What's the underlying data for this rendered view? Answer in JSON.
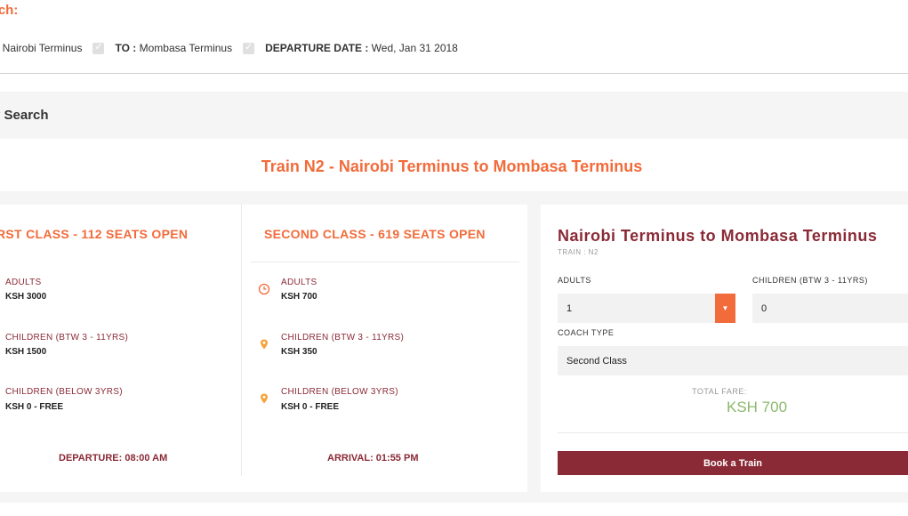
{
  "search_heading": "rch:",
  "summary": {
    "from_value": ": Nairobi Terminus",
    "to_label": "TO :",
    "to_value": " Mombasa Terminus",
    "date_label": "DEPARTURE DATE :",
    "date_value": " Wed, Jan 31 2018"
  },
  "modify_search": "y Search",
  "train_title": "Train N2 - Nairobi Terminus to Mombasa Terminus",
  "first_class": {
    "heading": "RST CLASS - 112 SEATS OPEN",
    "adults_label": "ADULTS",
    "adults_price": "KSH 3000",
    "children_label": "CHILDREN (BTW 3 - 11YRS)",
    "children_price": "KSH 1500",
    "infants_label": "CHILDREN (BELOW 3YRS)",
    "infants_price": "KSH 0 - FREE",
    "footer": "DEPARTURE: 08:00 AM"
  },
  "second_class": {
    "heading": "SECOND CLASS - 619 SEATS OPEN",
    "adults_label": "ADULTS",
    "adults_price": "KSH 700",
    "children_label": "CHILDREN (BTW 3 - 11YRS)",
    "children_price": "KSH 350",
    "infants_label": "CHILDREN (BELOW 3YRS)",
    "infants_price": "KSH 0 - FREE",
    "footer": "ARRIVAL: 01:55 PM"
  },
  "booking": {
    "route": "Nairobi Terminus to Mombasa Terminus",
    "train_no": "TRAIN : N2",
    "adults_label": "ADULTS",
    "adults_value": "1",
    "children_label": "CHILDREN (BTW 3 - 11YRS)",
    "children_value": "0",
    "coach_label": "COACH TYPE",
    "coach_value": "Second Class",
    "fare_label": "TOTAL FARE:",
    "fare_value": "KSH 700",
    "book_button": "Book a Train"
  },
  "icons": {
    "adults": "clock-icon",
    "children": "location-pin-icon",
    "dropdown": "chevron-down-icon",
    "checkbox": "check-icon"
  },
  "colors": {
    "accent": "#f26b3a",
    "maroon": "#8a2a36",
    "fare_green": "#8bb86b"
  }
}
